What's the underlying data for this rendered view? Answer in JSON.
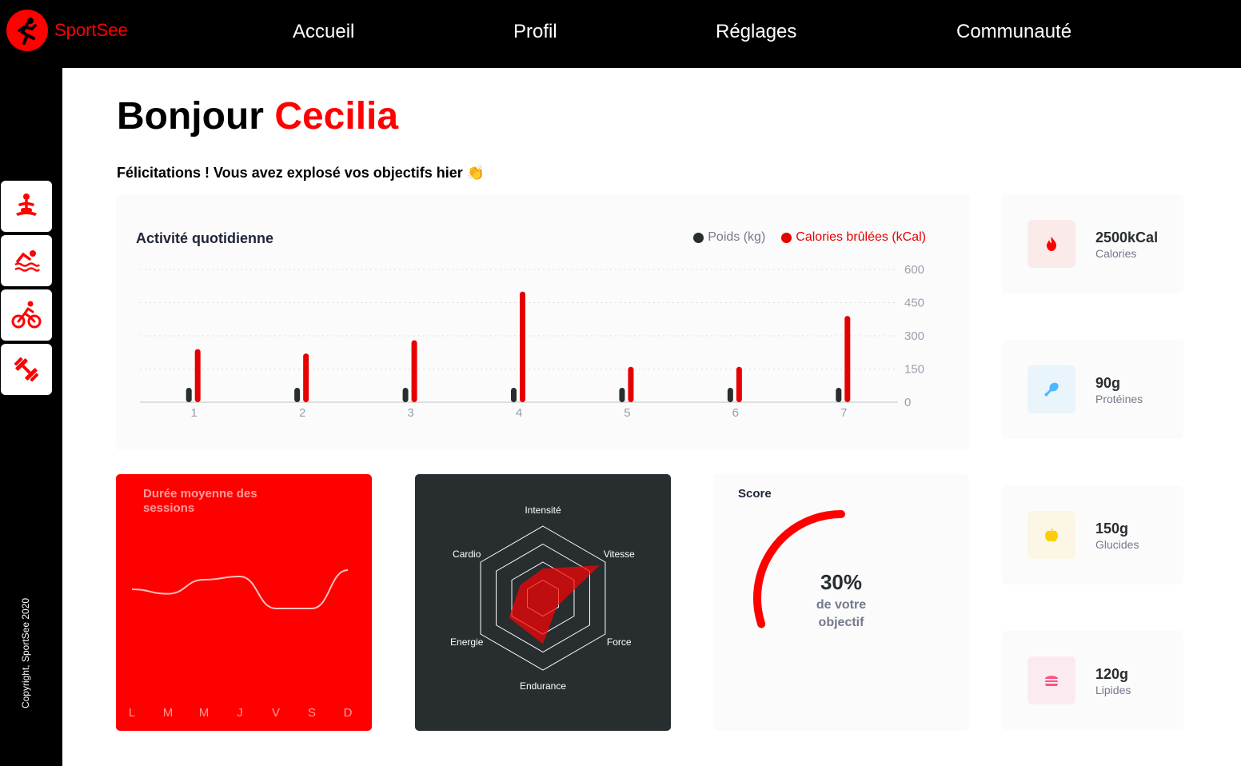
{
  "app": {
    "name": "SportSee"
  },
  "nav": {
    "items": [
      "Accueil",
      "Profil",
      "Réglages",
      "Communauté"
    ]
  },
  "sidebar": {
    "icons": [
      "yoga-icon",
      "swimming-icon",
      "cycling-icon",
      "dumbbell-icon"
    ],
    "copyright": "Copyright, SportSee 2020"
  },
  "greeting": {
    "hello": "Bonjour",
    "name": "Cecilia"
  },
  "congrats": "Félicitations ! Vous avez explosé vos objectifs hier 👏",
  "colors": {
    "brand": "#ff0101",
    "dark": "#282d30"
  },
  "activity": {
    "title": "Activité quotidienne",
    "legend_weight": "Poids (kg)",
    "legend_calories": "Calories brûlées (kCal)"
  },
  "sessions": {
    "title": "Durée moyenne des sessions"
  },
  "score": {
    "title": "Score",
    "value_text": "30%",
    "line1": "de votre",
    "line2": "objectif"
  },
  "kpis": [
    {
      "value": "2500kCal",
      "label": "Calories",
      "icon": "fire-icon",
      "bg": "#fbeaea",
      "color": "#ff0000"
    },
    {
      "value": "90g",
      "label": "Protéines",
      "icon": "chicken-icon",
      "bg": "#e9f4fb",
      "color": "#4ab8ff"
    },
    {
      "value": "150g",
      "label": "Glucides",
      "icon": "apple-icon",
      "bg": "#fbf6e5",
      "color": "#fdcc0c"
    },
    {
      "value": "120g",
      "label": "Lipides",
      "icon": "burger-icon",
      "bg": "#fbeaef",
      "color": "#fd5181"
    }
  ],
  "chart_data": [
    {
      "type": "bar",
      "title": "Activité quotidienne",
      "categories": [
        "1",
        "2",
        "3",
        "4",
        "5",
        "6",
        "7"
      ],
      "series": [
        {
          "name": "Poids (kg)",
          "values": [
            45,
            45,
            45,
            45,
            45,
            45,
            45
          ],
          "color": "#282d30"
        },
        {
          "name": "Calories brûlées (kCal)",
          "values": [
            240,
            220,
            280,
            500,
            160,
            160,
            390
          ],
          "color": "#e60000"
        }
      ],
      "ylim": [
        0,
        600
      ],
      "yticks": [
        0,
        150,
        300,
        450,
        600
      ],
      "grid": true,
      "legend": "top-right"
    },
    {
      "type": "line",
      "title": "Durée moyenne des sessions",
      "categories": [
        "L",
        "M",
        "M",
        "J",
        "V",
        "S",
        "D"
      ],
      "series": [
        {
          "values": [
            30,
            23,
            45,
            50,
            0,
            0,
            60
          ]
        }
      ]
    },
    {
      "type": "radar",
      "categories": [
        "Intensité",
        "Vitesse",
        "Force",
        "Endurance",
        "Energie",
        "Cardio"
      ],
      "series": [
        {
          "values": [
            90,
            200,
            50,
            140,
            120,
            80
          ]
        }
      ],
      "rmax": 220
    },
    {
      "type": "pie",
      "title": "Score",
      "values": [
        0.3
      ]
    }
  ]
}
